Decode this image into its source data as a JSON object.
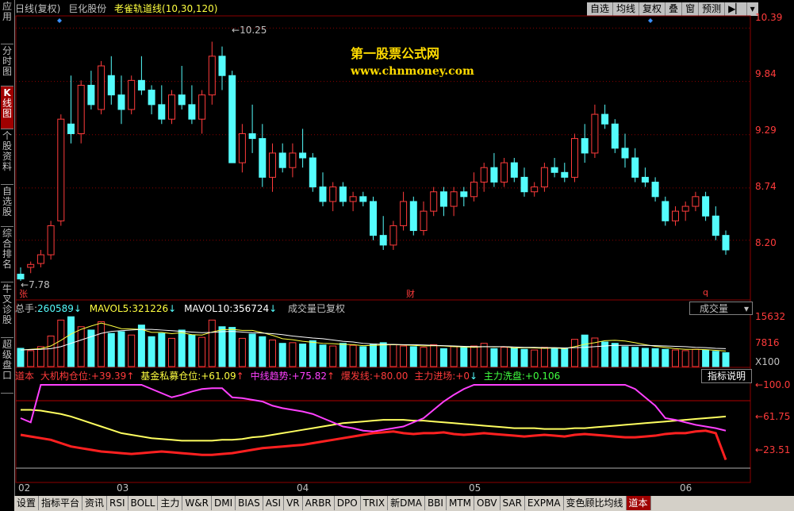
{
  "sidebar": [
    {
      "label": "应用"
    },
    {
      "label": "分时图"
    },
    {
      "label_k": "K",
      "label": "线图",
      "active": true
    },
    {
      "label": "个股资料"
    },
    {
      "label": "自选股"
    },
    {
      "label": "综合排名"
    },
    {
      "label": "牛叉诊股"
    },
    {
      "label": "超级盘口"
    }
  ],
  "title": {
    "period": "日线(复权)",
    "stock": "巨化股份",
    "indicator": "老雀轨道线(10,30,120)"
  },
  "toolbar": [
    "自选",
    "均线",
    "复权",
    "叠",
    "窗",
    "预测"
  ],
  "watermark": {
    "line1": "第一股票公式网",
    "line2": "www.chnmoney.com"
  },
  "price_axis": [
    "10.39",
    "9.84",
    "9.29",
    "8.74",
    "8.20"
  ],
  "annotations": {
    "high": "10.25",
    "low": "7.78",
    "mark_zhang": "张",
    "mark_cai": "财",
    "mark_q": "q"
  },
  "volume": {
    "total_label": "总手:",
    "total": "260589",
    "ma5_label": "MAVOL5:",
    "ma5": "321226",
    "ma10_label": "MAVOL10:",
    "ma10": "356724",
    "note": "成交量已复权",
    "select": "成交量",
    "axis": [
      "15632",
      "7816",
      "X100"
    ]
  },
  "indicator": {
    "name": "道本",
    "items": [
      {
        "label": "大机构仓位:",
        "value": "+39.39",
        "color": "#ff3b3b",
        "arrow": "up"
      },
      {
        "label": "基金私募仓位:",
        "value": "+61.09",
        "color": "#ffff40",
        "arrow": "up"
      },
      {
        "label": "中线趋势:",
        "value": "+75.82",
        "color": "#ff40ff",
        "arrow": "up"
      },
      {
        "label": "爆发线:",
        "value": "+80.00",
        "color": "#ff3b3b",
        "arrow": ""
      },
      {
        "label": "主力进场:",
        "value": "+0",
        "color": "#ff3b3b",
        "arrow": "down"
      },
      {
        "label": "主力洗盘:",
        "value": "+0.106",
        "color": "#40ff40",
        "arrow": ""
      }
    ],
    "help": "指标说明",
    "axis": [
      "100.0",
      "61.75",
      "23.51"
    ]
  },
  "xaxis": [
    {
      "label": "02"
    },
    {
      "label": "03"
    },
    {
      "label": "04"
    },
    {
      "label": "05"
    },
    {
      "label": "06"
    }
  ],
  "tabs": [
    "设置",
    "指标平台",
    "资讯",
    "RSI",
    "BOLL",
    "主力",
    "W&R",
    "DMI",
    "BIAS",
    "ASI",
    "VR",
    "ARBR",
    "DPO",
    "TRIX",
    "新DMA",
    "BBI",
    "MTM",
    "OBV",
    "SAR",
    "EXPMA",
    "变色顾比均线",
    "道本"
  ],
  "colors": {
    "up": "#ff3b3b",
    "down": "#54fcfc",
    "grid": "#8b0000",
    "axis": "#ff3b3b"
  },
  "chart_data": {
    "type": "candlestick",
    "ylim": [
      7.6,
      10.5
    ],
    "ohlc": [
      [
        7.85,
        7.92,
        7.78,
        7.8
      ],
      [
        7.92,
        7.98,
        7.86,
        7.95
      ],
      [
        7.96,
        8.1,
        7.92,
        8.05
      ],
      [
        8.05,
        8.4,
        8.0,
        8.35
      ],
      [
        8.4,
        9.5,
        8.35,
        9.45
      ],
      [
        9.4,
        9.9,
        9.2,
        9.3
      ],
      [
        9.3,
        9.85,
        9.2,
        9.8
      ],
      [
        9.8,
        9.95,
        9.55,
        9.6
      ],
      [
        9.55,
        10.05,
        9.5,
        10.0
      ],
      [
        9.9,
        10.1,
        9.6,
        9.7
      ],
      [
        9.7,
        9.9,
        9.4,
        9.55
      ],
      [
        9.55,
        9.9,
        9.5,
        9.85
      ],
      [
        9.85,
        10.1,
        9.7,
        9.75
      ],
      [
        9.75,
        9.8,
        9.5,
        9.6
      ],
      [
        9.6,
        9.8,
        9.4,
        9.45
      ],
      [
        9.45,
        9.75,
        9.4,
        9.7
      ],
      [
        9.7,
        10.0,
        9.55,
        9.6
      ],
      [
        9.6,
        9.8,
        9.4,
        9.45
      ],
      [
        9.45,
        9.75,
        9.3,
        9.7
      ],
      [
        9.7,
        10.25,
        9.6,
        10.1
      ],
      [
        10.1,
        10.2,
        9.75,
        9.9
      ],
      [
        9.9,
        9.95,
        9.3,
        9.0
      ],
      [
        9.0,
        9.4,
        8.9,
        9.3
      ],
      [
        9.3,
        9.6,
        9.1,
        9.25
      ],
      [
        9.25,
        9.4,
        8.75,
        8.85
      ],
      [
        8.85,
        9.2,
        8.7,
        9.1
      ],
      [
        9.1,
        9.2,
        8.9,
        8.95
      ],
      [
        8.95,
        9.2,
        8.85,
        9.1
      ],
      [
        9.1,
        9.35,
        8.95,
        9.05
      ],
      [
        9.05,
        9.1,
        8.7,
        8.75
      ],
      [
        8.75,
        8.9,
        8.55,
        8.6
      ],
      [
        8.6,
        8.8,
        8.5,
        8.75
      ],
      [
        8.75,
        8.8,
        8.55,
        8.6
      ],
      [
        8.6,
        8.7,
        8.5,
        8.65
      ],
      [
        8.65,
        8.7,
        8.55,
        8.6
      ],
      [
        8.6,
        8.65,
        8.2,
        8.25
      ],
      [
        8.25,
        8.45,
        8.1,
        8.15
      ],
      [
        8.15,
        8.4,
        8.1,
        8.35
      ],
      [
        8.35,
        8.7,
        8.3,
        8.6
      ],
      [
        8.6,
        8.65,
        8.25,
        8.3
      ],
      [
        8.3,
        8.6,
        8.25,
        8.5
      ],
      [
        8.5,
        8.75,
        8.45,
        8.7
      ],
      [
        8.7,
        8.75,
        8.45,
        8.55
      ],
      [
        8.55,
        8.75,
        8.45,
        8.7
      ],
      [
        8.7,
        8.75,
        8.55,
        8.65
      ],
      [
        8.65,
        8.9,
        8.6,
        8.8
      ],
      [
        8.8,
        9.0,
        8.7,
        8.95
      ],
      [
        8.95,
        9.1,
        8.75,
        8.8
      ],
      [
        8.8,
        9.05,
        8.75,
        9.0
      ],
      [
        9.0,
        9.05,
        8.8,
        8.85
      ],
      [
        8.85,
        8.95,
        8.65,
        8.7
      ],
      [
        8.7,
        8.8,
        8.65,
        8.75
      ],
      [
        8.75,
        9.0,
        8.7,
        8.95
      ],
      [
        8.95,
        9.05,
        8.85,
        8.9
      ],
      [
        8.9,
        9.0,
        8.8,
        8.85
      ],
      [
        8.85,
        9.3,
        8.8,
        9.25
      ],
      [
        9.25,
        9.4,
        9.0,
        9.1
      ],
      [
        9.1,
        9.6,
        9.05,
        9.5
      ],
      [
        9.5,
        9.6,
        9.35,
        9.4
      ],
      [
        9.4,
        9.45,
        9.1,
        9.15
      ],
      [
        9.15,
        9.3,
        8.95,
        9.05
      ],
      [
        9.05,
        9.15,
        8.8,
        8.85
      ],
      [
        8.85,
        8.95,
        8.75,
        8.8
      ],
      [
        8.8,
        8.85,
        8.6,
        8.65
      ],
      [
        8.6,
        8.65,
        8.35,
        8.4
      ],
      [
        8.4,
        8.55,
        8.35,
        8.5
      ],
      [
        8.5,
        8.6,
        8.4,
        8.55
      ],
      [
        8.55,
        8.7,
        8.5,
        8.65
      ],
      [
        8.65,
        8.7,
        8.4,
        8.45
      ],
      [
        8.45,
        8.55,
        8.2,
        8.25
      ],
      [
        8.25,
        8.3,
        8.05,
        8.1
      ]
    ],
    "volume": [
      55,
      48,
      60,
      92,
      140,
      150,
      120,
      110,
      135,
      100,
      105,
      95,
      125,
      90,
      100,
      85,
      110,
      95,
      88,
      140,
      120,
      118,
      85,
      98,
      90,
      80,
      70,
      72,
      68,
      78,
      65,
      62,
      70,
      64,
      60,
      68,
      72,
      66,
      62,
      60,
      58,
      66,
      54,
      60,
      58,
      62,
      70,
      54,
      58,
      56,
      52,
      50,
      58,
      55,
      54,
      82,
      95,
      86,
      74,
      70,
      60,
      58,
      55,
      54,
      52,
      50,
      48,
      52,
      50,
      46,
      42
    ],
    "ma5": [
      50,
      52,
      54,
      62,
      79,
      98,
      112,
      122,
      131,
      123,
      114,
      113,
      112,
      103,
      103,
      99,
      102,
      96,
      95,
      104,
      111,
      112,
      109,
      109,
      102,
      94,
      84,
      81,
      76,
      73,
      70,
      69,
      67,
      66,
      63,
      64,
      65,
      66,
      65,
      64,
      62,
      63,
      62,
      60,
      59,
      58,
      60,
      59,
      60,
      56,
      57,
      56,
      55,
      56,
      54,
      60,
      67,
      72,
      78,
      79,
      77,
      72,
      66,
      61,
      58,
      54,
      52,
      52,
      51,
      49,
      47
    ],
    "ma10": [
      50,
      51,
      52,
      54,
      60,
      70,
      80,
      90,
      100,
      106,
      108,
      110,
      112,
      112,
      110,
      108,
      106,
      104,
      102,
      103,
      105,
      106,
      104,
      102,
      101,
      99,
      96,
      92,
      89,
      86,
      84,
      80,
      76,
      74,
      70,
      68,
      67,
      67,
      66,
      66,
      65,
      64,
      63,
      62,
      61,
      60,
      60,
      60,
      60,
      59,
      58,
      58,
      57,
      57,
      56,
      57,
      58,
      60,
      62,
      64,
      64,
      64,
      64,
      63,
      62,
      61,
      60,
      58,
      57,
      55,
      54
    ],
    "ind_red": [
      40,
      38,
      36,
      34,
      30,
      26,
      24,
      22,
      20,
      19,
      18,
      17,
      18,
      19,
      20,
      19,
      18,
      17,
      16,
      16,
      17,
      18,
      20,
      22,
      24,
      25,
      26,
      27,
      28,
      30,
      32,
      34,
      36,
      38,
      40,
      42,
      43,
      44,
      42,
      41,
      42,
      42,
      43,
      41,
      40,
      41,
      42,
      41,
      40,
      39,
      38,
      39,
      40,
      39,
      38,
      40,
      41,
      40,
      39,
      38,
      37,
      37,
      38,
      39,
      41,
      42,
      42,
      44,
      45,
      42,
      10
    ],
    "ind_yellow": [
      70,
      70,
      69,
      67,
      65,
      62,
      58,
      54,
      50,
      46,
      42,
      40,
      38,
      36,
      35,
      34,
      33,
      33,
      33,
      33,
      34,
      34,
      35,
      37,
      38,
      40,
      42,
      44,
      46,
      48,
      50,
      52,
      54,
      55,
      56,
      57,
      58,
      58,
      58,
      57,
      57,
      56,
      55,
      54,
      53,
      52,
      51,
      50,
      49,
      48,
      48,
      48,
      47,
      47,
      47,
      48,
      48,
      49,
      50,
      51,
      52,
      53,
      54,
      55,
      56,
      57,
      58,
      59,
      60,
      61,
      62
    ],
    "ind_magenta": [
      60,
      55,
      100,
      100,
      100,
      100,
      100,
      100,
      100,
      100,
      100,
      100,
      100,
      95,
      90,
      85,
      88,
      92,
      95,
      96,
      96,
      85,
      84,
      82,
      80,
      75,
      72,
      70,
      68,
      65,
      60,
      55,
      50,
      48,
      45,
      44,
      46,
      48,
      50,
      55,
      60,
      70,
      80,
      88,
      95,
      100,
      100,
      100,
      100,
      100,
      100,
      100,
      100,
      100,
      100,
      100,
      100,
      100,
      100,
      100,
      100,
      95,
      85,
      75,
      60,
      58,
      55,
      52,
      50,
      48,
      45
    ]
  }
}
